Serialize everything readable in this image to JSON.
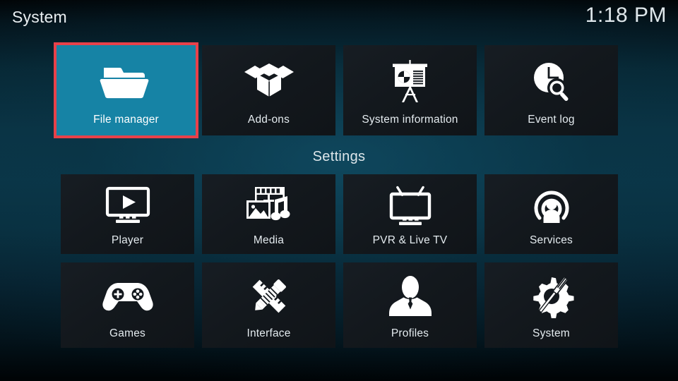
{
  "window": {
    "title": "System",
    "clock": "1:18 PM"
  },
  "theme": {
    "selection_fill": "#1683a5",
    "selection_border": "#e8414a",
    "tile_fill": "#13181d",
    "text_color": "#e4ebef",
    "background_top": "#010406",
    "background_mid": "#0a3547",
    "background_bottom": "#000305"
  },
  "sections": {
    "top_row": {
      "items": [
        {
          "label": "File manager",
          "icon": "folder-icon",
          "selected": true
        },
        {
          "label": "Add-ons",
          "icon": "open-box-icon",
          "selected": false
        },
        {
          "label": "System information",
          "icon": "presentation-chart-icon",
          "selected": false
        },
        {
          "label": "Event log",
          "icon": "clock-search-icon",
          "selected": false
        }
      ]
    },
    "settings": {
      "header": "Settings",
      "rows": [
        {
          "items": [
            {
              "label": "Player",
              "icon": "monitor-play-icon",
              "selected": false
            },
            {
              "label": "Media",
              "icon": "film-photo-music-icon",
              "selected": false
            },
            {
              "label": "PVR & Live TV",
              "icon": "tv-antenna-icon",
              "selected": false
            },
            {
              "label": "Services",
              "icon": "broadcast-person-icon",
              "selected": false
            }
          ]
        },
        {
          "items": [
            {
              "label": "Games",
              "icon": "gamepad-icon",
              "selected": false
            },
            {
              "label": "Interface",
              "icon": "pencil-ruler-icon",
              "selected": false
            },
            {
              "label": "Profiles",
              "icon": "person-bust-icon",
              "selected": false
            },
            {
              "label": "System",
              "icon": "gear-screwdriver-icon",
              "selected": false
            }
          ]
        }
      ]
    }
  }
}
